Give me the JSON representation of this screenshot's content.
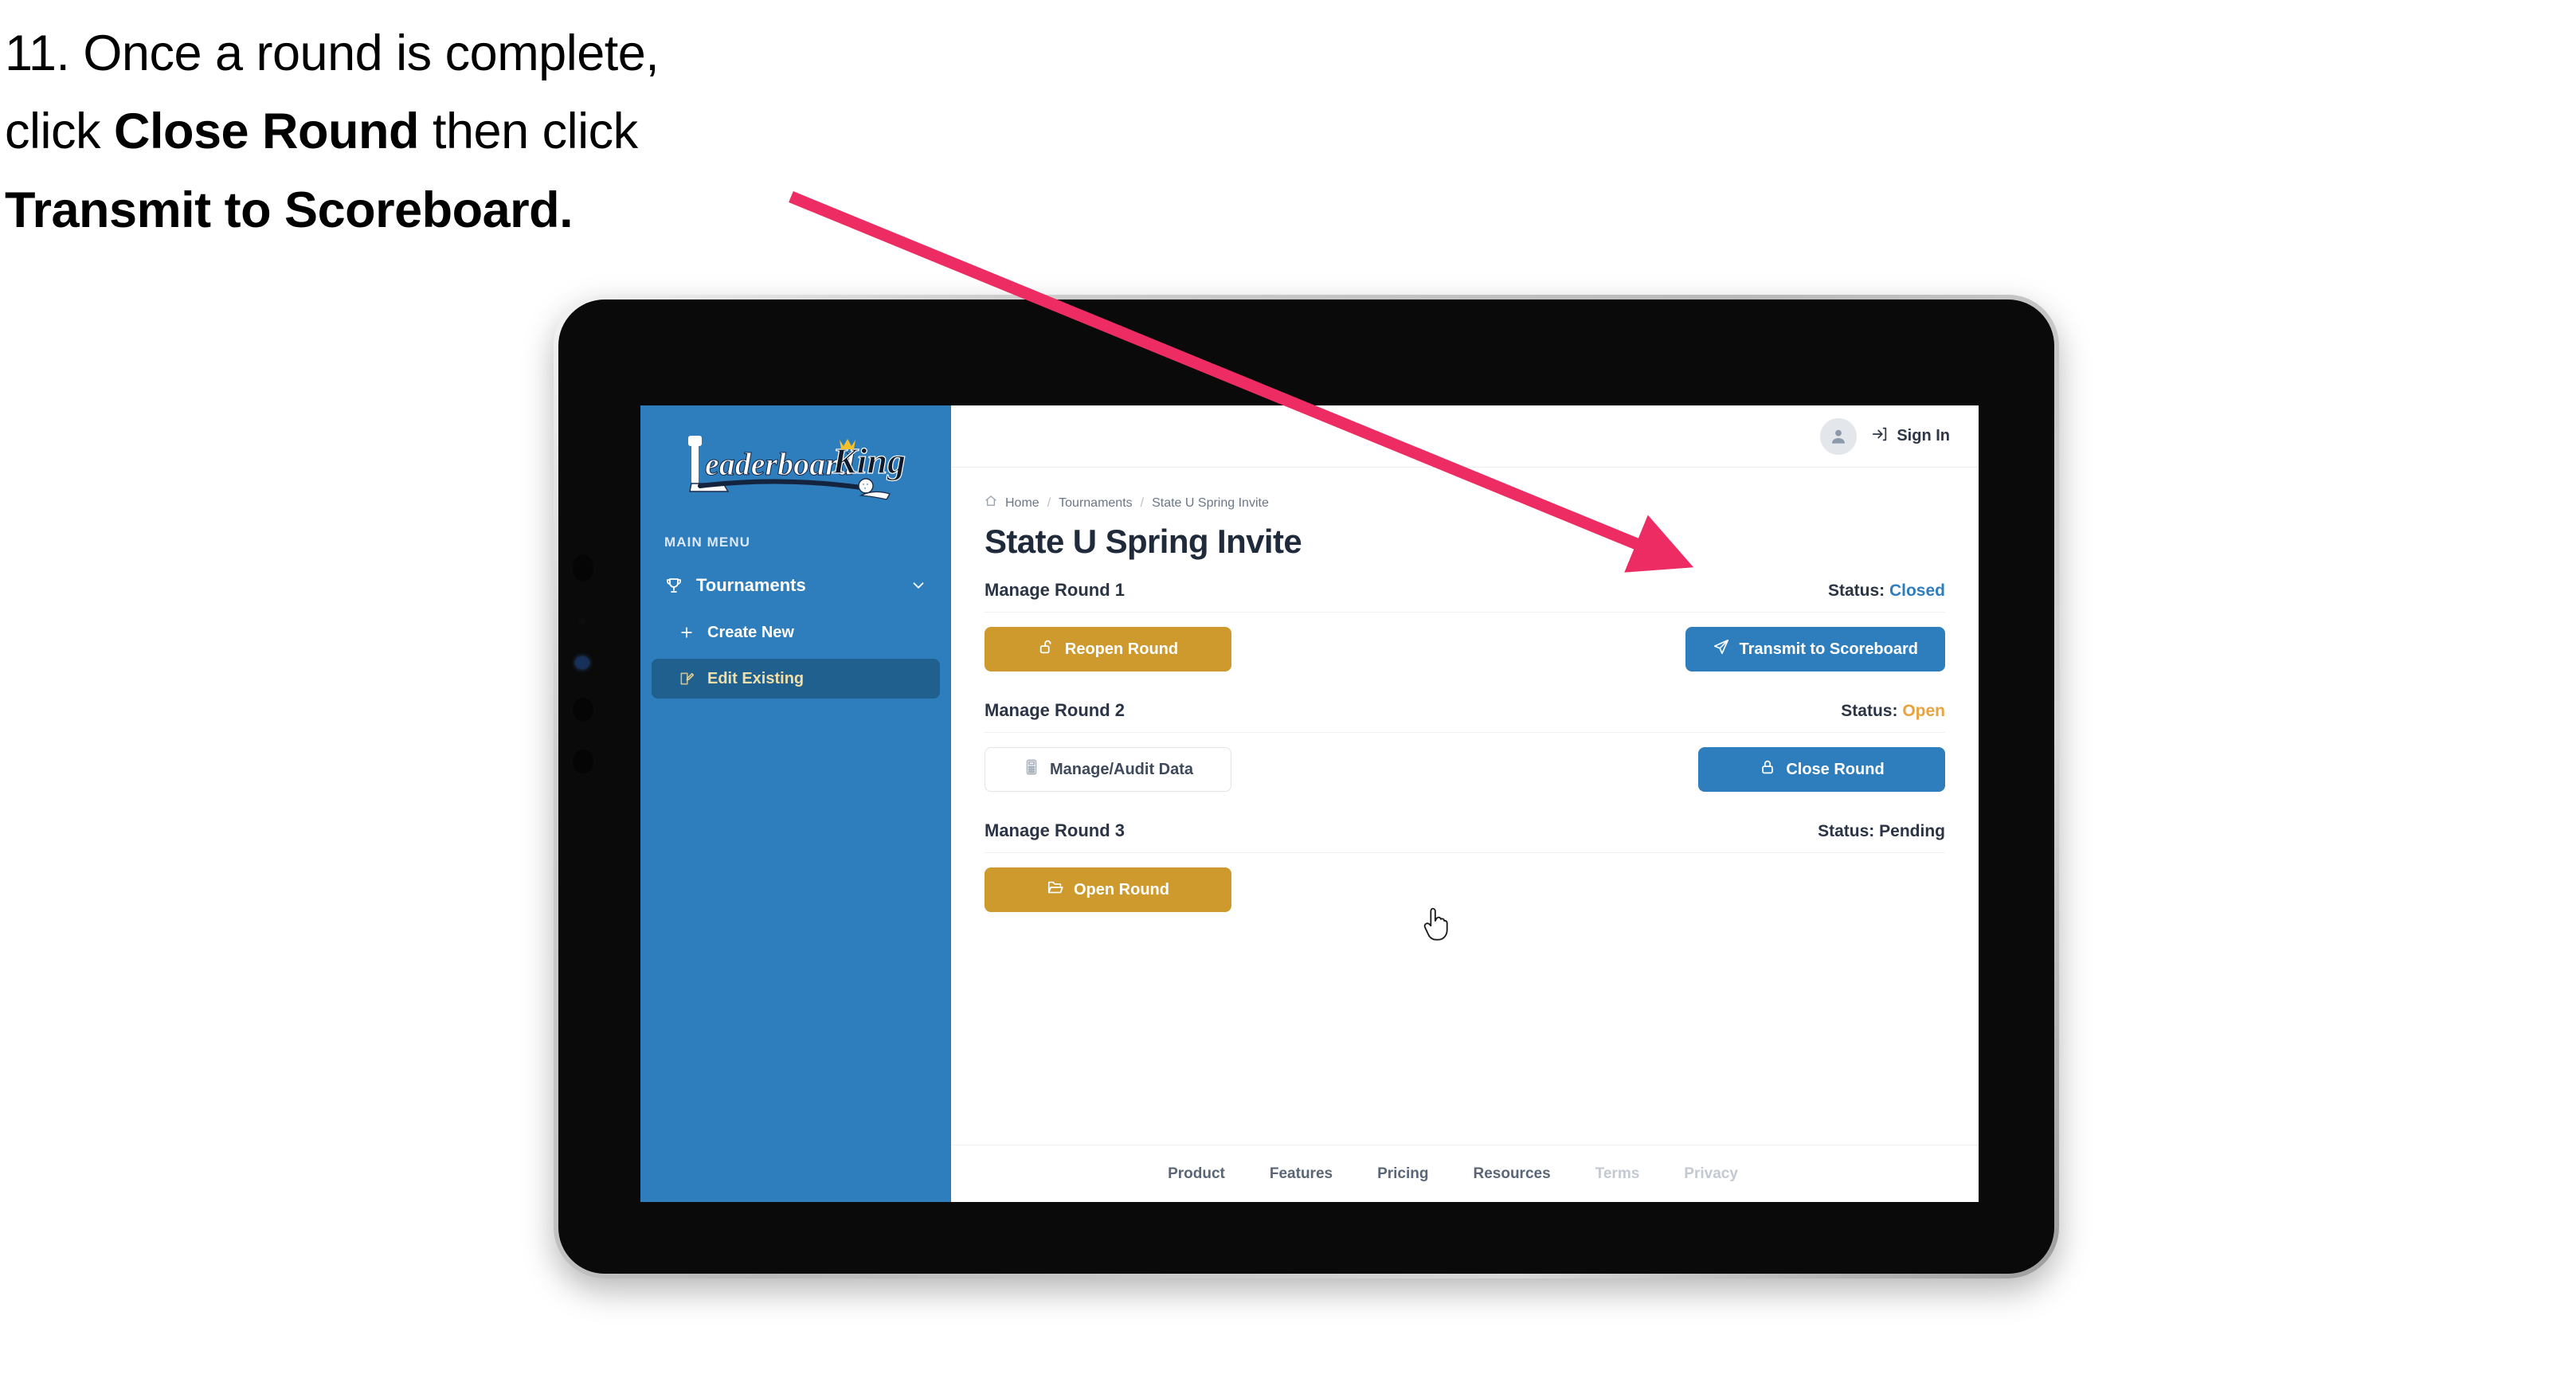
{
  "caption": {
    "line1_plain": "11. Once a round is complete,",
    "line2_pre": "click ",
    "line2_bold": "Close Round",
    "line2_post": " then click",
    "line3_bold": "Transmit to Scoreboard."
  },
  "sidebar": {
    "logo_text": "LeaderboardKing",
    "menu_label": "MAIN MENU",
    "nav": [
      {
        "label": "Tournaments",
        "icon": "trophy-icon",
        "chevron": "chevron-down-icon",
        "active": false
      },
      {
        "label": "Create New",
        "icon": "plus-icon",
        "active": false
      },
      {
        "label": "Edit Existing",
        "icon": "edit-square-icon",
        "active": true
      }
    ],
    "bg_color": "#2E7EBE",
    "active_bg_color": "#20608F",
    "active_text_color": "#F0DFA8"
  },
  "topbar": {
    "avatar_icon": "user-avatar-icon",
    "signin_icon": "login-arrow-icon",
    "signin_label": "Sign In"
  },
  "breadcrumb": {
    "home_icon": "home-icon",
    "items": [
      "Home",
      "Tournaments",
      "State U Spring Invite"
    ],
    "separator": "/"
  },
  "page": {
    "title": "State U Spring Invite"
  },
  "rounds": [
    {
      "title": "Manage Round 1",
      "status_label": "Status:",
      "status_value": "Closed",
      "status_color": "#2E7EBE",
      "left_button": {
        "label": "Reopen Round",
        "icon": "unlock-icon",
        "style": "gold"
      },
      "right_button": {
        "label": "Transmit to Scoreboard",
        "icon": "paper-plane-icon",
        "style": "blue"
      }
    },
    {
      "title": "Manage Round 2",
      "status_label": "Status:",
      "status_value": "Open",
      "status_color": "#E8A33D",
      "left_button": {
        "label": "Manage/Audit Data",
        "icon": "calculator-icon",
        "style": "ghost"
      },
      "right_button": {
        "label": "Close Round",
        "icon": "lock-icon",
        "style": "blue"
      }
    },
    {
      "title": "Manage Round 3",
      "status_label": "Status:",
      "status_value": "Pending",
      "status_color": "#2B3445",
      "left_button": {
        "label": "Open Round",
        "icon": "open-folder-icon",
        "style": "gold"
      },
      "right_button": null
    }
  ],
  "footer": {
    "links": [
      {
        "label": "Product",
        "dim": false
      },
      {
        "label": "Features",
        "dim": false
      },
      {
        "label": "Pricing",
        "dim": false
      },
      {
        "label": "Resources",
        "dim": false
      },
      {
        "label": "Terms",
        "dim": true
      },
      {
        "label": "Privacy",
        "dim": true
      }
    ]
  },
  "annotation": {
    "arrow_color": "#EC2C62",
    "points_to": "Transmit to Scoreboard"
  },
  "cursor": {
    "type": "pointing-hand"
  }
}
